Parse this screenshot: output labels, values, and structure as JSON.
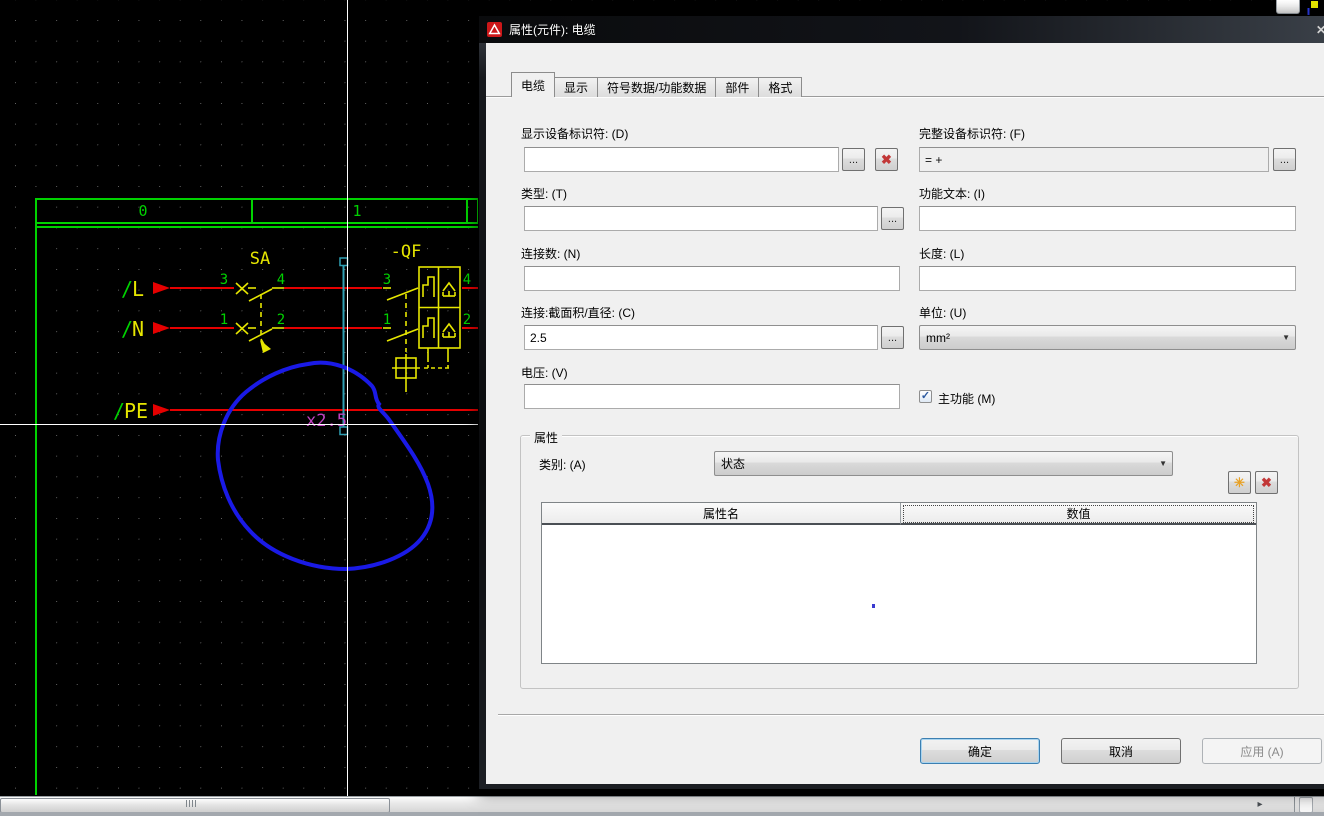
{
  "window": {
    "title": "属性(元件): 电缆",
    "close_glyph": "✕"
  },
  "tabs": {
    "items": [
      {
        "label": "电缆"
      },
      {
        "label": "显示"
      },
      {
        "label": "符号数据/功能数据"
      },
      {
        "label": "部件"
      },
      {
        "label": "格式"
      }
    ]
  },
  "form": {
    "display_dt": {
      "label": "显示设备标识符: (D)",
      "value": ""
    },
    "full_dt": {
      "label": "完整设备标识符: (F)",
      "value": "= +"
    },
    "type": {
      "label": "类型: (T)",
      "value": ""
    },
    "func_text": {
      "label": "功能文本: (I)",
      "value": ""
    },
    "conn_count": {
      "label": "连接数: (N)",
      "value": ""
    },
    "length": {
      "label": "长度: (L)",
      "value": ""
    },
    "cross_section": {
      "label": "连接:截面积/直径: (C)",
      "value": "2.5"
    },
    "unit": {
      "label": "单位: (U)",
      "value": "mm²"
    },
    "voltage": {
      "label": "电压: (V)",
      "value": ""
    },
    "main_function": {
      "label": "主功能 (M)",
      "checked": true,
      "check_glyph": "✓"
    },
    "browse_glyph": "...",
    "delete_glyph": "✖",
    "new_glyph": "✳",
    "combo_arrow": "▼"
  },
  "properties": {
    "group_title": "属性",
    "category_label": "类别: (A)",
    "category_value": "状态",
    "columns": [
      "属性名",
      "数值"
    ],
    "rows": []
  },
  "buttons": {
    "ok": "确定",
    "cancel": "取消",
    "apply": "应用 (A)"
  },
  "canvas": {
    "ruler_cols": [
      "0",
      "1"
    ],
    "wire_labels": [
      {
        "slash": "/",
        "name": "L"
      },
      {
        "slash": "/",
        "name": "N"
      },
      {
        "slash": "/",
        "name": "PE"
      }
    ],
    "sa_label": "SA",
    "qf_label": "-QF",
    "sa_contacts": [
      "3",
      "4",
      "1",
      "2"
    ],
    "qf_contacts": [
      "3",
      "4",
      "1",
      "2"
    ],
    "cross_section_text": "x2.5"
  },
  "scrollbar": {
    "arrow_right": "▸"
  },
  "colors": {
    "cad_green": "#00d200",
    "cad_red": "#e60000",
    "cad_yellow": "#e6e600",
    "cad_cyan": "#2fa0b4",
    "cad_magenta": "#c243c2",
    "annotation_blue": "#1a1ae6",
    "dialog_bg": "#f0f0f0",
    "title_bg": "#0a0b0d"
  }
}
